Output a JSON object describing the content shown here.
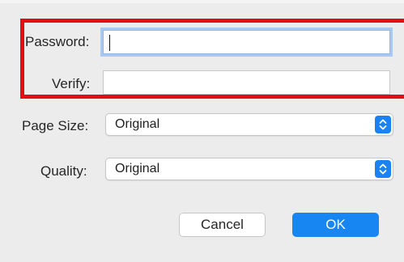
{
  "form": {
    "password_label": "Password:",
    "password_value": "",
    "verify_label": "Verify:",
    "verify_value": "",
    "page_size_label": "Page Size:",
    "page_size_value": "Original",
    "quality_label": "Quality:",
    "quality_value": "Original"
  },
  "buttons": {
    "cancel_label": "Cancel",
    "ok_label": "OK"
  },
  "icons": {
    "stepper": "up-down-chevron-icon"
  },
  "colors": {
    "highlight": "#e30e0e",
    "accent": "#1786f3",
    "focus_ring": "#a9c9f2",
    "background": "#ececec"
  }
}
